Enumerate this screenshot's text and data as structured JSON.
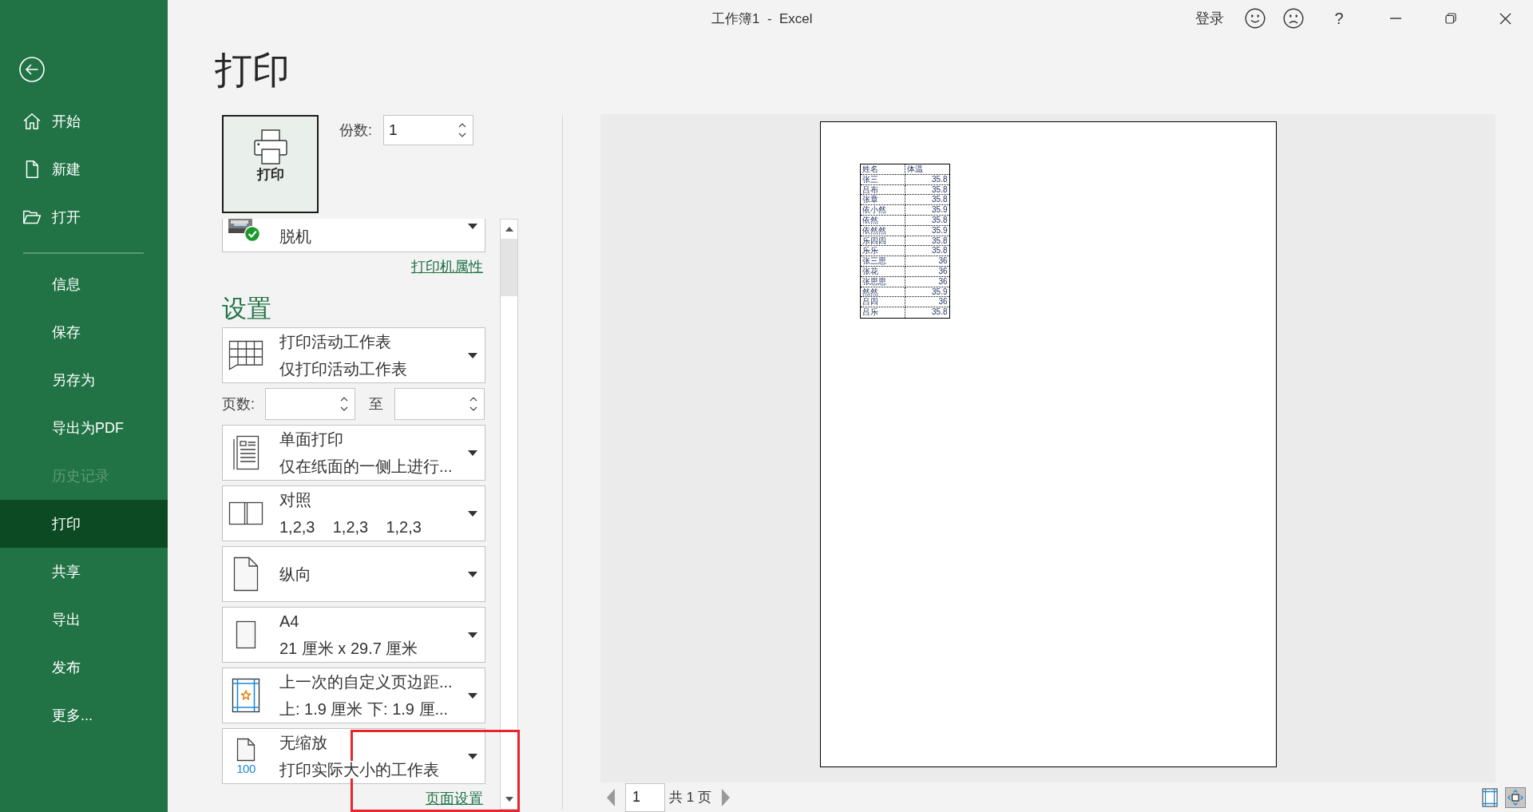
{
  "window": {
    "title": "工作簿1  -  Excel",
    "account": "登录",
    "help": "?"
  },
  "sidebar": {
    "items": [
      {
        "label": "开始",
        "selected": false,
        "disabled": false
      },
      {
        "label": "新建",
        "selected": false,
        "disabled": false
      },
      {
        "label": "打开",
        "selected": false,
        "disabled": false
      }
    ],
    "lower_items": [
      {
        "label": "信息",
        "selected": false,
        "disabled": false
      },
      {
        "label": "保存",
        "selected": false,
        "disabled": false
      },
      {
        "label": "另存为",
        "selected": false,
        "disabled": false
      },
      {
        "label": "导出为PDF",
        "selected": false,
        "disabled": false
      },
      {
        "label": "历史记录",
        "selected": false,
        "disabled": true
      },
      {
        "label": "打印",
        "selected": true,
        "disabled": false
      },
      {
        "label": "共享",
        "selected": false,
        "disabled": false
      },
      {
        "label": "导出",
        "selected": false,
        "disabled": false
      },
      {
        "label": "发布",
        "selected": false,
        "disabled": false
      },
      {
        "label": "更多...",
        "selected": false,
        "disabled": false
      }
    ]
  },
  "print": {
    "heading": "打印",
    "button": "打印",
    "copies": {
      "label": "份数:",
      "value": "1"
    }
  },
  "printer": {
    "status": "脱机",
    "properties_link": "打印机属性"
  },
  "settings": {
    "title": "设置",
    "items": [
      {
        "kind": "sheets",
        "title": "打印活动工作表",
        "subtitle": "仅打印活动工作表"
      },
      {
        "kind": "range",
        "label": "页数:",
        "separator": "至"
      },
      {
        "kind": "sides",
        "title": "单面打印",
        "subtitle": "仅在纸面的一侧上进行..."
      },
      {
        "kind": "collation",
        "title": "对照",
        "subtitle": "1,2,3    1,2,3    1,2,3"
      },
      {
        "kind": "orientation",
        "title": "纵向"
      },
      {
        "kind": "paper",
        "title": "A4",
        "subtitle": "21 厘米 x 29.7 厘米"
      },
      {
        "kind": "margins",
        "title": "上一次的自定义页边距...",
        "subtitle": "上: 1.9 厘米 下: 1.9 厘..."
      },
      {
        "kind": "scaling",
        "icon_label": "100",
        "title": "无缩放",
        "subtitle": "打印实际大小的工作表"
      }
    ],
    "page_setup_link": "页面设置"
  },
  "preview": {
    "table": {
      "columns": [
        "姓名",
        "体温"
      ],
      "rows": [
        [
          "张三",
          "35.8"
        ],
        [
          "吕布",
          "35.8"
        ],
        [
          "张章",
          "35.8"
        ],
        [
          "依小然",
          "35.9"
        ],
        [
          "依然",
          "35.8"
        ],
        [
          "依然然",
          "35.9"
        ],
        [
          "乐四四",
          "35.8"
        ],
        [
          "乐乐",
          "35.8"
        ],
        [
          "张三思",
          "36"
        ],
        [
          "张花",
          "36"
        ],
        [
          "张思思",
          "36"
        ],
        [
          "然然",
          "35.9"
        ],
        [
          "吕四",
          "36"
        ],
        [
          "吕乐",
          "35.8"
        ]
      ]
    },
    "page": {
      "value": "1",
      "total": "共 1 页"
    },
    "views": [
      {
        "kind": "margins",
        "selected": false
      },
      {
        "kind": "page_zoom",
        "selected": true
      }
    ]
  }
}
